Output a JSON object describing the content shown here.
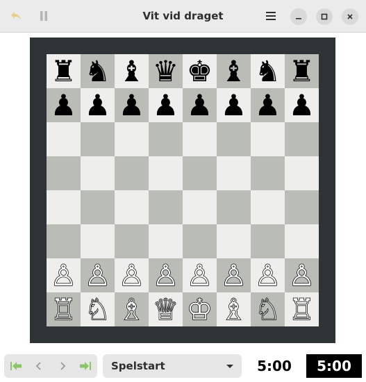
{
  "window": {
    "title": "Vit vid draget"
  },
  "colors": {
    "frame": "#2e3436",
    "light_square": "#eeeeec",
    "dark_square": "#babdb6",
    "nav_arrow_green": "#8ac56a",
    "undo_arrow": "#e5cf8f"
  },
  "headerbar": {
    "undo_icon": "undo-arrow-icon",
    "pause_icon": "pause-icon",
    "menu_icon": "hamburger-menu-icon",
    "minimize_icon": "minimize-icon",
    "maximize_icon": "maximize-icon",
    "close_icon": "close-icon"
  },
  "board": {
    "rows": [
      [
        "♜",
        "♞",
        "♝",
        "♛",
        "♚",
        "♝",
        "♞",
        "♜"
      ],
      [
        "♟",
        "♟",
        "♟",
        "♟",
        "♟",
        "♟",
        "♟",
        "♟"
      ],
      [
        "",
        "",
        "",
        "",
        "",
        "",
        "",
        ""
      ],
      [
        "",
        "",
        "",
        "",
        "",
        "",
        "",
        ""
      ],
      [
        "",
        "",
        "",
        "",
        "",
        "",
        "",
        ""
      ],
      [
        "",
        "",
        "",
        "",
        "",
        "",
        "",
        ""
      ],
      [
        "♙",
        "♙",
        "♙",
        "♙",
        "♙",
        "♙",
        "♙",
        "♙"
      ],
      [
        "♖",
        "♘",
        "♗",
        "♕",
        "♔",
        "♗",
        "♘",
        "♖"
      ]
    ],
    "piece_names": [
      [
        "black-rook",
        "black-knight",
        "black-bishop",
        "black-queen",
        "black-king",
        "black-bishop",
        "black-knight",
        "black-rook"
      ],
      [
        "black-pawn",
        "black-pawn",
        "black-pawn",
        "black-pawn",
        "black-pawn",
        "black-pawn",
        "black-pawn",
        "black-pawn"
      ],
      [],
      [],
      [],
      [],
      [
        "white-pawn",
        "white-pawn",
        "white-pawn",
        "white-pawn",
        "white-pawn",
        "white-pawn",
        "white-pawn",
        "white-pawn"
      ],
      [
        "white-rook",
        "white-knight",
        "white-bishop",
        "white-queen",
        "white-king",
        "white-bishop",
        "white-knight",
        "white-rook"
      ]
    ]
  },
  "navigation": {
    "first_icon": "go-first-icon",
    "previous_icon": "go-previous-icon",
    "next_icon": "go-next-icon",
    "last_icon": "go-last-icon"
  },
  "move_selector": {
    "selected": "Spelstart",
    "arrow_icon": "dropdown-arrow-icon"
  },
  "clocks": {
    "white": "5:00",
    "black": "5:00"
  }
}
